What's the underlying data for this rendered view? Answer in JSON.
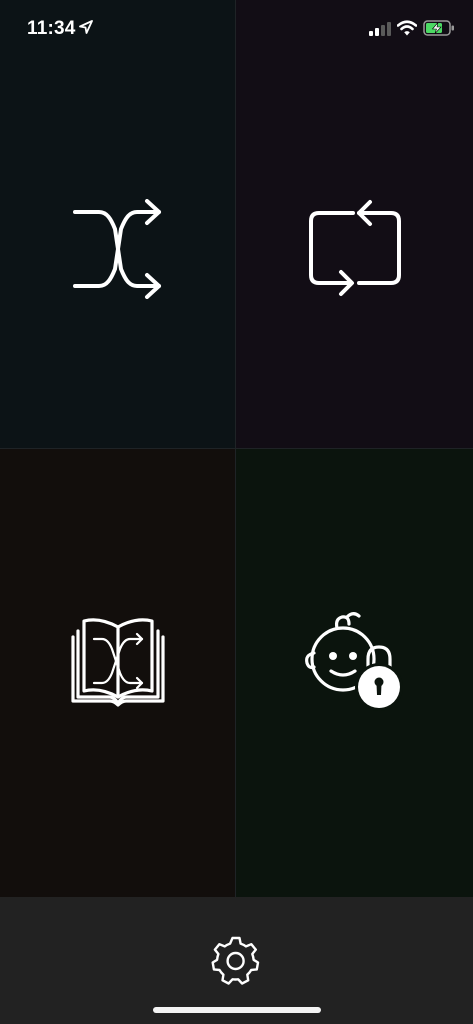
{
  "status_bar": {
    "time": "11:34",
    "location_icon": "location-arrow-icon",
    "signal_icon": "cellular-signal-icon",
    "wifi_icon": "wifi-icon",
    "battery_icon": "battery-charging-icon",
    "battery_color": "#4cd964"
  },
  "tiles": [
    {
      "id": "shuffle",
      "icon": "shuffle-icon",
      "background": "#0c1316"
    },
    {
      "id": "repeat",
      "icon": "repeat-icon",
      "background": "#120d15"
    },
    {
      "id": "story-book",
      "icon": "book-shuffle-icon",
      "background": "#120e0c"
    },
    {
      "id": "kid-lock",
      "icon": "baby-lock-icon",
      "background": "#0b140d"
    }
  ],
  "bottom_bar": {
    "settings_icon": "gear-icon",
    "background": "#222222"
  }
}
